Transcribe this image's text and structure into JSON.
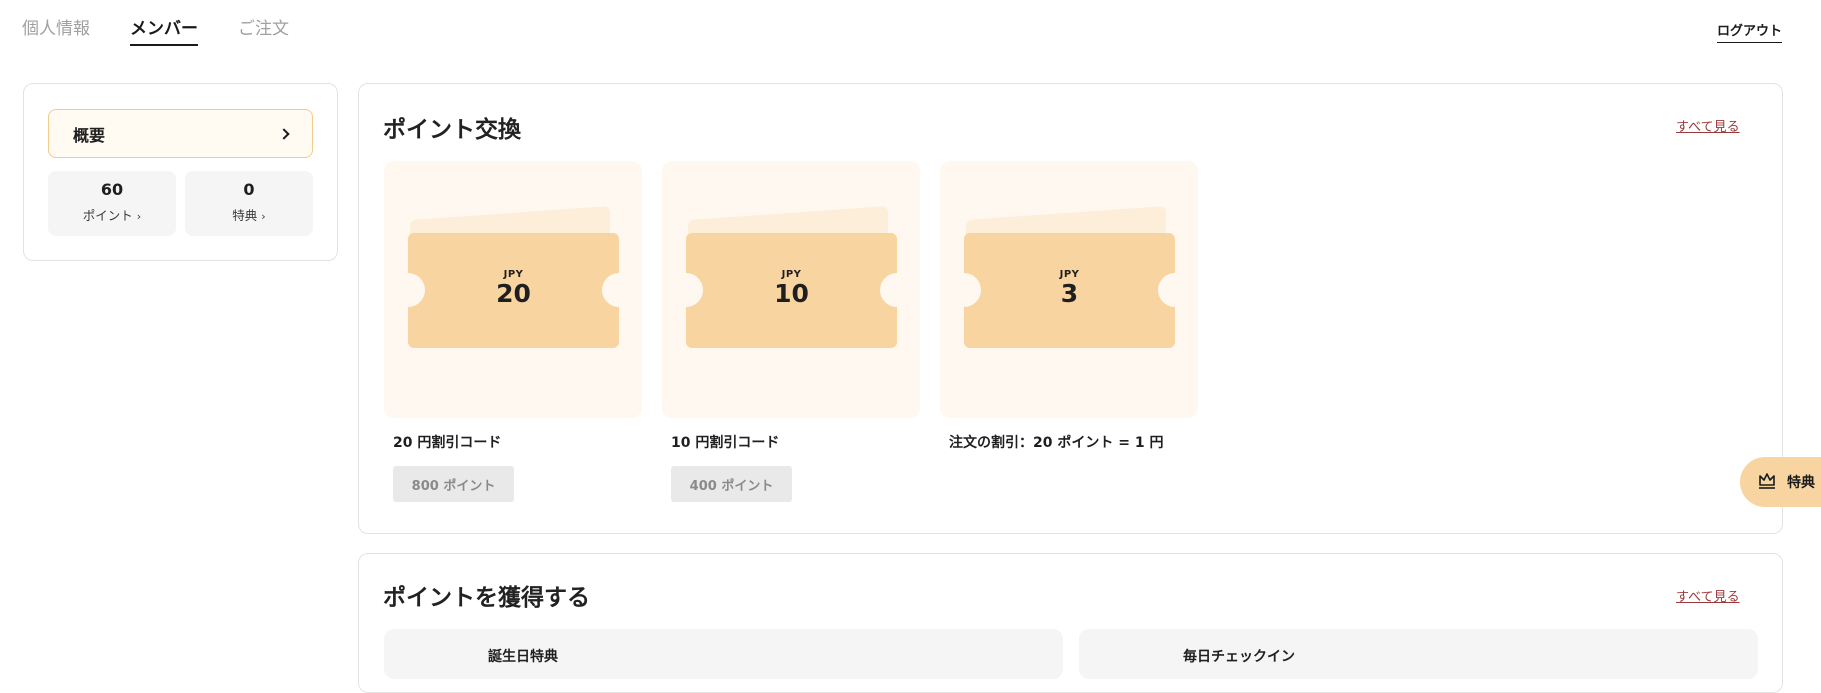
{
  "nav": {
    "tabs": [
      {
        "label": "個人情報"
      },
      {
        "label": "メンバー"
      },
      {
        "label": "ご注文"
      }
    ],
    "logout": "ログアウト"
  },
  "sidebar": {
    "overview": "概要",
    "stats": [
      {
        "value": "60",
        "label": "ポイント",
        "arrow": "›"
      },
      {
        "value": "0",
        "label": "特典",
        "arrow": "›"
      }
    ]
  },
  "exchange": {
    "title": "ポイント交換",
    "see_all": "すべて見る",
    "coupons": [
      {
        "currency": "JPY",
        "amount": "20",
        "name": "20 円割引コード",
        "points": "800 ポイント",
        "has_button": true
      },
      {
        "currency": "JPY",
        "amount": "10",
        "name": "10 円割引コード",
        "points": "400 ポイント",
        "has_button": true
      },
      {
        "currency": "JPY",
        "amount": "3",
        "name": "注文の割引：20 ポイント = 1 円",
        "has_button": false
      }
    ]
  },
  "earn": {
    "title": "ポイントを獲得する",
    "see_all": "すべて見る",
    "items": [
      {
        "title": "誕生日特典"
      },
      {
        "title": "毎日チェックイン"
      }
    ]
  },
  "floating": {
    "label": "特典",
    "icon": "crown-icon"
  },
  "colors": {
    "accent": "#f8d4a0",
    "accent_light": "#fff8f1",
    "link": "#9b3a3a"
  }
}
